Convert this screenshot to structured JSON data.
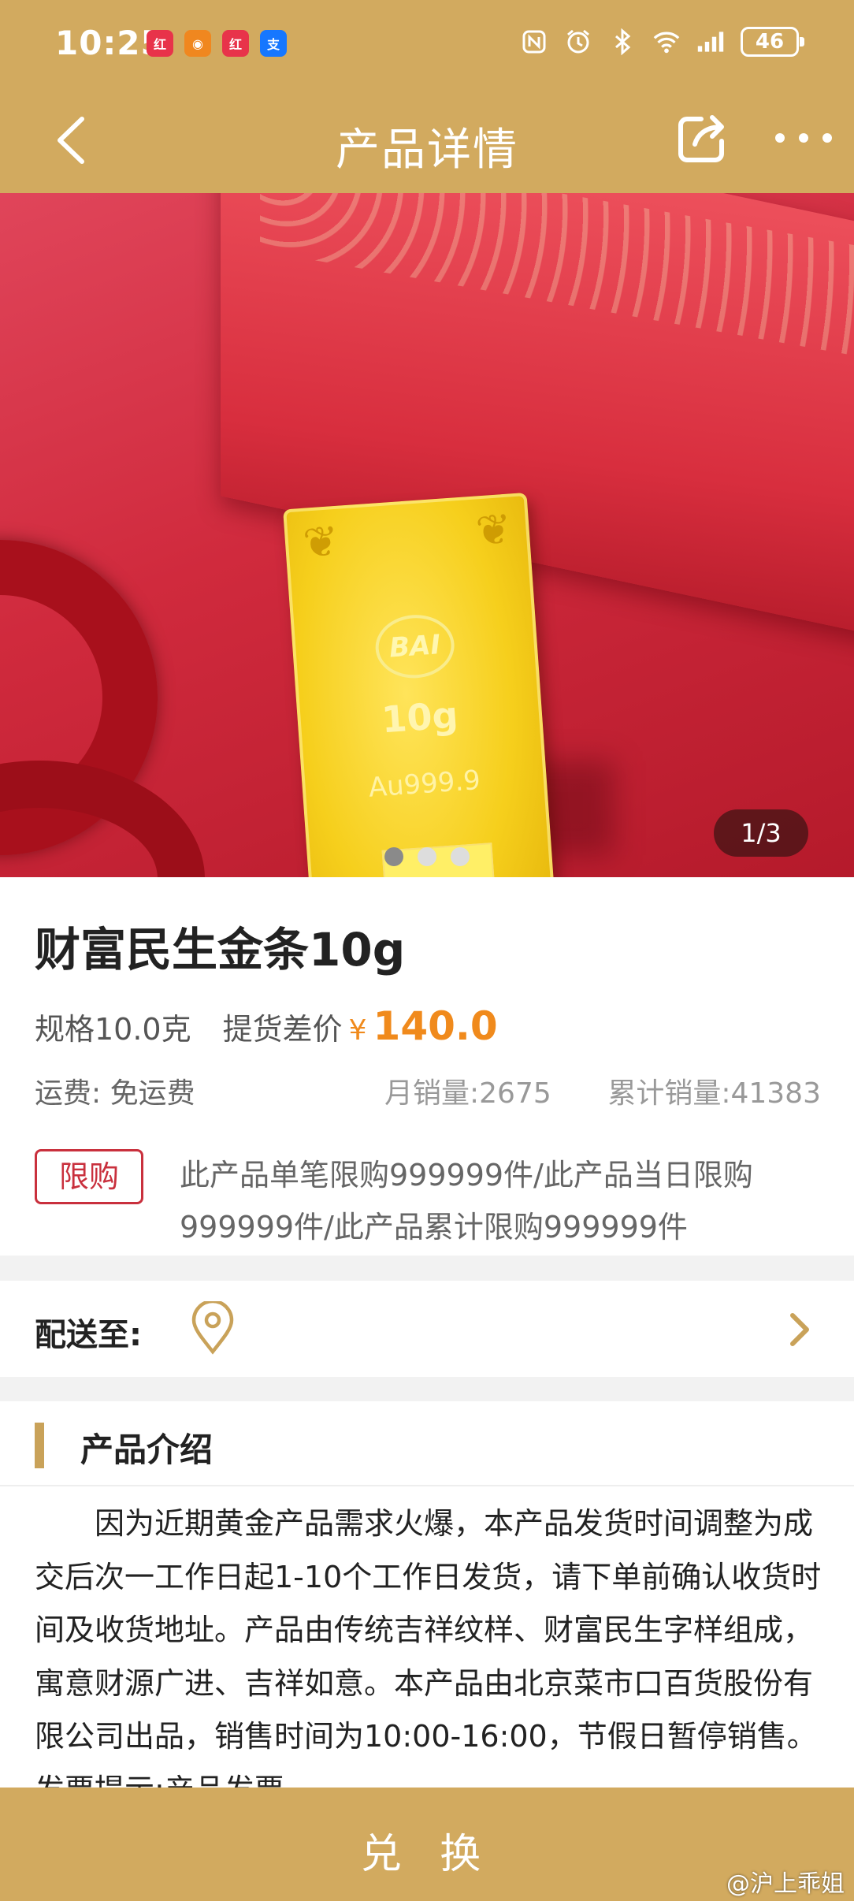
{
  "status_bar": {
    "time": "10:25",
    "battery": "46",
    "apps": [
      {
        "icon": "xiaohongshu-app-icon",
        "color": "#e8334a"
      },
      {
        "icon": "orange-app-icon",
        "color": "#f0871f"
      },
      {
        "icon": "xiaohongshu-app-icon",
        "color": "#e8334a"
      },
      {
        "icon": "alipay-icon",
        "color": "#1677ff"
      }
    ]
  },
  "header": {
    "title": "产品详情",
    "back_icon": "back-chevron-icon",
    "share_icon": "share-icon",
    "more_icon": "more-icon"
  },
  "hero": {
    "bar_weight": "10g",
    "bar_purity": "Au999.9",
    "logo_text": "BAI",
    "counter": "1/3",
    "dots_total": 3,
    "dots_active": 0
  },
  "product": {
    "name": "财富民生金条10g",
    "spec": "规格10.0克",
    "diff_label": "提货差价",
    "currency": "¥",
    "price": "140.0",
    "shipping": "运费: 免运费",
    "monthly_sales": "月销量:2675",
    "total_sales": "累计销量:41383",
    "limit_badge": "限购",
    "limit_text": "此产品单笔限购999999件/此产品当日限购999999件/此产品累计限购999999件"
  },
  "delivery": {
    "label": "配送至:",
    "pin_icon": "location-pin-icon",
    "chevron_icon": "chevron-right-icon"
  },
  "intro": {
    "title": "产品介绍",
    "body": "因为近期黄金产品需求火爆，本产品发货时间调整为成交后次一工作日起1-10个工作日发货，请下单前确认收货时间及收货地址。产品由传统吉祥纹样、财富民生字样组成，寓意财源广进、吉祥如意。本产品由北京菜市口百货股份有限公司出品，销售时间为10:00-16:00，节假日暂停销售。发票提示:产品发票"
  },
  "bottom": {
    "button": "兑 换",
    "watermark": "@沪上乖姐"
  },
  "colors": {
    "brand_gold": "#d2aa5f",
    "price_orange": "#f08a1c",
    "limit_red": "#c9303d"
  }
}
